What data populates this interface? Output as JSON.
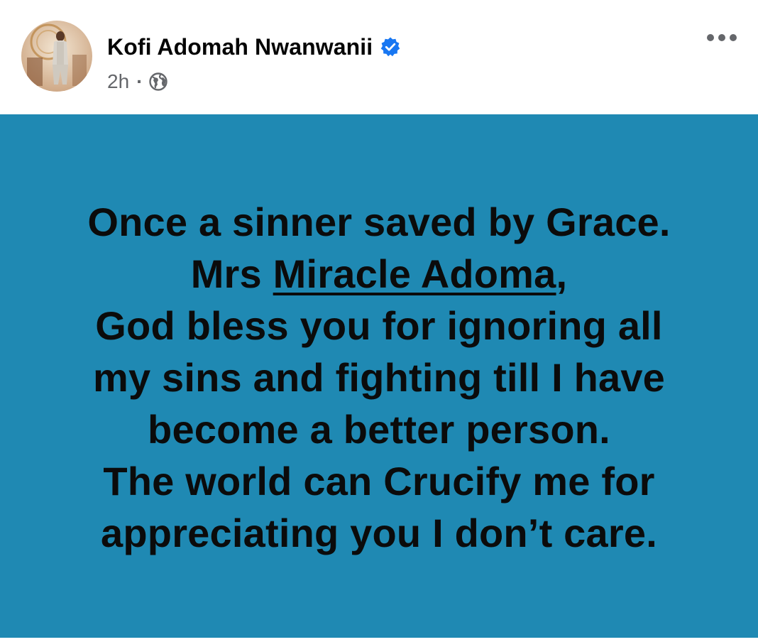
{
  "post": {
    "author": {
      "name": "Kofi Adomah Nwanwanii",
      "verified_icon": "verified-badge-icon",
      "avatar_icon": "profile-photo"
    },
    "meta": {
      "timestamp": "2h",
      "separator": "·",
      "audience_icon": "globe-icon"
    },
    "more_options_icon": "more-options-icon",
    "content": {
      "background_color": "#1f89b3",
      "text_color": "#0b0b0b",
      "line1": "Once a sinner saved by Grace.",
      "line2_prefix": "Mrs ",
      "mention": "Miracle Adoma",
      "line2_suffix": ",",
      "line3": "God bless you for ignoring all",
      "line4": "my sins and fighting till I have",
      "line5": "become a better person.",
      "line6": "The world can Crucify me for",
      "line7": "appreciating you I don’t care."
    }
  },
  "colors": {
    "verified_blue": "#1877f2",
    "meta_gray": "#65676b"
  }
}
